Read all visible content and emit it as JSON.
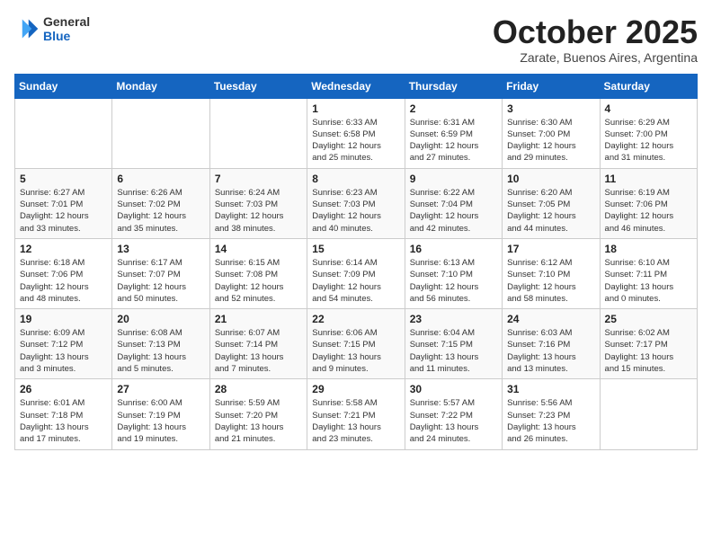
{
  "logo": {
    "general": "General",
    "blue": "Blue"
  },
  "header": {
    "month": "October 2025",
    "location": "Zarate, Buenos Aires, Argentina"
  },
  "weekdays": [
    "Sunday",
    "Monday",
    "Tuesday",
    "Wednesday",
    "Thursday",
    "Friday",
    "Saturday"
  ],
  "weeks": [
    [
      {
        "day": "",
        "info": ""
      },
      {
        "day": "",
        "info": ""
      },
      {
        "day": "",
        "info": ""
      },
      {
        "day": "1",
        "info": "Sunrise: 6:33 AM\nSunset: 6:58 PM\nDaylight: 12 hours\nand 25 minutes."
      },
      {
        "day": "2",
        "info": "Sunrise: 6:31 AM\nSunset: 6:59 PM\nDaylight: 12 hours\nand 27 minutes."
      },
      {
        "day": "3",
        "info": "Sunrise: 6:30 AM\nSunset: 7:00 PM\nDaylight: 12 hours\nand 29 minutes."
      },
      {
        "day": "4",
        "info": "Sunrise: 6:29 AM\nSunset: 7:00 PM\nDaylight: 12 hours\nand 31 minutes."
      }
    ],
    [
      {
        "day": "5",
        "info": "Sunrise: 6:27 AM\nSunset: 7:01 PM\nDaylight: 12 hours\nand 33 minutes."
      },
      {
        "day": "6",
        "info": "Sunrise: 6:26 AM\nSunset: 7:02 PM\nDaylight: 12 hours\nand 35 minutes."
      },
      {
        "day": "7",
        "info": "Sunrise: 6:24 AM\nSunset: 7:03 PM\nDaylight: 12 hours\nand 38 minutes."
      },
      {
        "day": "8",
        "info": "Sunrise: 6:23 AM\nSunset: 7:03 PM\nDaylight: 12 hours\nand 40 minutes."
      },
      {
        "day": "9",
        "info": "Sunrise: 6:22 AM\nSunset: 7:04 PM\nDaylight: 12 hours\nand 42 minutes."
      },
      {
        "day": "10",
        "info": "Sunrise: 6:20 AM\nSunset: 7:05 PM\nDaylight: 12 hours\nand 44 minutes."
      },
      {
        "day": "11",
        "info": "Sunrise: 6:19 AM\nSunset: 7:06 PM\nDaylight: 12 hours\nand 46 minutes."
      }
    ],
    [
      {
        "day": "12",
        "info": "Sunrise: 6:18 AM\nSunset: 7:06 PM\nDaylight: 12 hours\nand 48 minutes."
      },
      {
        "day": "13",
        "info": "Sunrise: 6:17 AM\nSunset: 7:07 PM\nDaylight: 12 hours\nand 50 minutes."
      },
      {
        "day": "14",
        "info": "Sunrise: 6:15 AM\nSunset: 7:08 PM\nDaylight: 12 hours\nand 52 minutes."
      },
      {
        "day": "15",
        "info": "Sunrise: 6:14 AM\nSunset: 7:09 PM\nDaylight: 12 hours\nand 54 minutes."
      },
      {
        "day": "16",
        "info": "Sunrise: 6:13 AM\nSunset: 7:10 PM\nDaylight: 12 hours\nand 56 minutes."
      },
      {
        "day": "17",
        "info": "Sunrise: 6:12 AM\nSunset: 7:10 PM\nDaylight: 12 hours\nand 58 minutes."
      },
      {
        "day": "18",
        "info": "Sunrise: 6:10 AM\nSunset: 7:11 PM\nDaylight: 13 hours\nand 0 minutes."
      }
    ],
    [
      {
        "day": "19",
        "info": "Sunrise: 6:09 AM\nSunset: 7:12 PM\nDaylight: 13 hours\nand 3 minutes."
      },
      {
        "day": "20",
        "info": "Sunrise: 6:08 AM\nSunset: 7:13 PM\nDaylight: 13 hours\nand 5 minutes."
      },
      {
        "day": "21",
        "info": "Sunrise: 6:07 AM\nSunset: 7:14 PM\nDaylight: 13 hours\nand 7 minutes."
      },
      {
        "day": "22",
        "info": "Sunrise: 6:06 AM\nSunset: 7:15 PM\nDaylight: 13 hours\nand 9 minutes."
      },
      {
        "day": "23",
        "info": "Sunrise: 6:04 AM\nSunset: 7:15 PM\nDaylight: 13 hours\nand 11 minutes."
      },
      {
        "day": "24",
        "info": "Sunrise: 6:03 AM\nSunset: 7:16 PM\nDaylight: 13 hours\nand 13 minutes."
      },
      {
        "day": "25",
        "info": "Sunrise: 6:02 AM\nSunset: 7:17 PM\nDaylight: 13 hours\nand 15 minutes."
      }
    ],
    [
      {
        "day": "26",
        "info": "Sunrise: 6:01 AM\nSunset: 7:18 PM\nDaylight: 13 hours\nand 17 minutes."
      },
      {
        "day": "27",
        "info": "Sunrise: 6:00 AM\nSunset: 7:19 PM\nDaylight: 13 hours\nand 19 minutes."
      },
      {
        "day": "28",
        "info": "Sunrise: 5:59 AM\nSunset: 7:20 PM\nDaylight: 13 hours\nand 21 minutes."
      },
      {
        "day": "29",
        "info": "Sunrise: 5:58 AM\nSunset: 7:21 PM\nDaylight: 13 hours\nand 23 minutes."
      },
      {
        "day": "30",
        "info": "Sunrise: 5:57 AM\nSunset: 7:22 PM\nDaylight: 13 hours\nand 24 minutes."
      },
      {
        "day": "31",
        "info": "Sunrise: 5:56 AM\nSunset: 7:23 PM\nDaylight: 13 hours\nand 26 minutes."
      },
      {
        "day": "",
        "info": ""
      }
    ]
  ]
}
